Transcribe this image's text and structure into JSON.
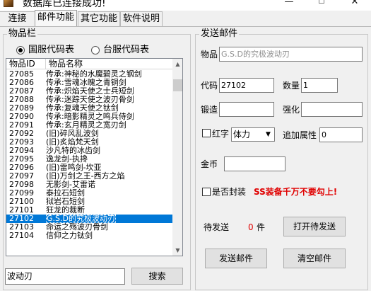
{
  "window": {
    "title": "数据库已连接成功!",
    "minimize_glyph": "—",
    "maximize_glyph": "☐",
    "close_glyph": "✕"
  },
  "tabs": [
    "连接",
    "邮件功能",
    "其它功能",
    "软件说明"
  ],
  "item_panel": {
    "legend": "物品栏",
    "radio_cn": "国服代码表",
    "radio_tw": "台服代码表",
    "col_id": "物品ID",
    "col_name": "物品名称",
    "rows": [
      {
        "id": "27085",
        "name": "传承:神秘的水魔碧灵之钢剑"
      },
      {
        "id": "27086",
        "name": "传承:雪魂冰魄之青铜剑"
      },
      {
        "id": "27087",
        "name": "传承:炽焰天使之士兵短剑"
      },
      {
        "id": "27088",
        "name": "传承:迷踪天使之波刃骨剑"
      },
      {
        "id": "27089",
        "name": "传承:复魂天使之钛剑"
      },
      {
        "id": "27090",
        "name": "传承:暗影精灵之鸣兵侍剑"
      },
      {
        "id": "27091",
        "name": "传承:玄月精灵之宽刃剑"
      },
      {
        "id": "27092",
        "name": "(旧)碎风乱波剑"
      },
      {
        "id": "27093",
        "name": "(旧)炙焰梵天剑"
      },
      {
        "id": "27094",
        "name": "沙凡特的冰齿剑"
      },
      {
        "id": "27095",
        "name": "逸龙剑-执搀"
      },
      {
        "id": "27096",
        "name": "(旧)雷鸣剑-坎亚"
      },
      {
        "id": "27097",
        "name": "(旧)万剑之王-西方之焰"
      },
      {
        "id": "27098",
        "name": "无影剑-艾雷诺"
      },
      {
        "id": "27099",
        "name": "泰拉石短剑"
      },
      {
        "id": "27100",
        "name": "狱岩石短剑"
      },
      {
        "id": "27101",
        "name": "狂龙的裁断"
      },
      {
        "id": "27102",
        "name": "G.S.D的究极波动刃"
      },
      {
        "id": "27103",
        "name": "命运之殇波刃骨剑"
      },
      {
        "id": "27104",
        "name": "信仰之力钛剑"
      }
    ],
    "selected_index": 17,
    "search_value": "波动刃",
    "search_button": "搜索"
  },
  "mail": {
    "legend": "发送邮件",
    "item_label": "物品",
    "item_value": "G.S.D的究极波动刃",
    "code_label": "代码",
    "code_value": "27102",
    "qty_label": "数量",
    "qty_value": "1",
    "forge_label": "锻造",
    "forge_value": "",
    "enhance_label": "强化",
    "enhance_value": "",
    "redname_label": "红字",
    "attr_select_value": "体力",
    "extra_attr_label": "追加属性",
    "extra_attr_value": "0",
    "gold_label": "金币",
    "gold_value": "",
    "sealed_label": "是否封装",
    "warning": "SS装备千万不要勾上!",
    "pending_label": "待发送",
    "pending_count": "0",
    "pending_unit": "件",
    "refresh_button": "打开待发送",
    "send_button": "发送邮件",
    "clear_button": "清空邮件"
  },
  "colors": {
    "accent_selection": "#0078d7",
    "warning_red": "#e00000"
  }
}
